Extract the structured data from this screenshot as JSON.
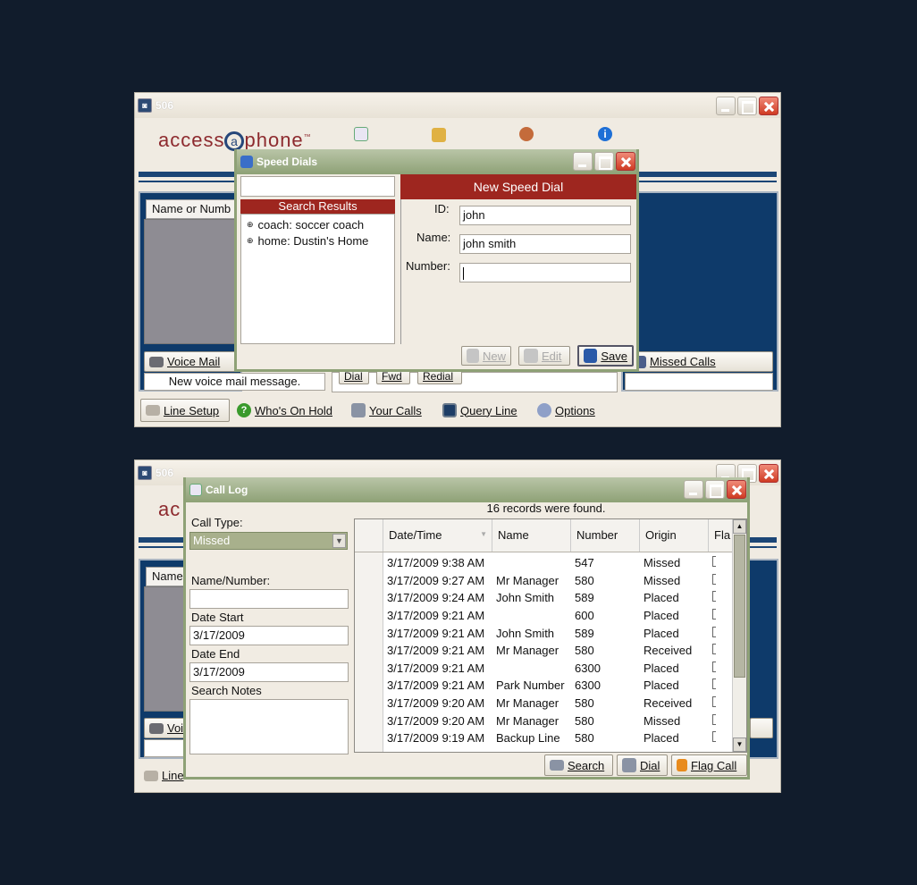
{
  "main_window": {
    "title": "506",
    "logo_text_before": "access",
    "logo_at": "a",
    "logo_text_after": "phone",
    "logo_tm": "™",
    "name_col_header": "Name or Numb",
    "voice_mail_label": "Voice Mail",
    "voice_mail_message": "New voice mail message.",
    "missed_calls_label": "Missed Calls",
    "call_buttons": {
      "dial": "Dial",
      "fwd": "Fwd",
      "redial": "Redial"
    },
    "toolbar": {
      "line_setup": "Line Setup",
      "whos_on_hold": "Who's On Hold",
      "your_calls": "Your Calls",
      "query_line": "Query Line",
      "options": "Options"
    }
  },
  "speed_dials": {
    "title": "Speed Dials",
    "search_value": "",
    "search_results_header": "Search Results",
    "results": [
      {
        "id": "coach",
        "name": "soccer coach",
        "text": "coach: soccer coach"
      },
      {
        "id": "home",
        "name": "Dustin's Home",
        "text": "home: Dustin's Home"
      }
    ],
    "form_header": "New Speed Dial",
    "id_label": "ID:",
    "id_value": "john",
    "name_label": "Name:",
    "name_value": "john smith",
    "number_label": "Number:",
    "number_value": "",
    "buttons": {
      "new": "New",
      "edit": "Edit",
      "save": "Save"
    }
  },
  "second_window": {
    "title": "506",
    "logo_partial": "ac",
    "name_col_partial": "Name",
    "voice_partial": "Voi",
    "line_partial": "Line"
  },
  "call_log": {
    "title": "Call Log",
    "records_found": "16 records were found.",
    "call_type_label": "Call Type:",
    "call_type_value": "Missed",
    "name_number_label": "Name/Number:",
    "name_number_value": "",
    "date_start_label": "Date Start",
    "date_start_value": "3/17/2009",
    "date_end_label": "Date End",
    "date_end_value": "3/17/2009",
    "search_notes_label": "Search Notes",
    "search_notes_value": "",
    "columns": [
      "Date/Time",
      "Name",
      "Number",
      "Origin",
      "Fla"
    ],
    "rows": [
      {
        "datetime": "3/17/2009 9:38 AM",
        "name": "",
        "number": "547",
        "origin": "Missed"
      },
      {
        "datetime": "3/17/2009 9:27 AM",
        "name": "Mr Manager",
        "number": "580",
        "origin": "Missed"
      },
      {
        "datetime": "3/17/2009 9:24 AM",
        "name": "John Smith",
        "number": "589",
        "origin": "Placed"
      },
      {
        "datetime": "3/17/2009 9:21 AM",
        "name": "",
        "number": "600",
        "origin": "Placed"
      },
      {
        "datetime": "3/17/2009 9:21 AM",
        "name": "John Smith",
        "number": "589",
        "origin": "Placed"
      },
      {
        "datetime": "3/17/2009 9:21 AM",
        "name": "Mr Manager",
        "number": "580",
        "origin": "Received"
      },
      {
        "datetime": "3/17/2009 9:21 AM",
        "name": "",
        "number": "6300",
        "origin": "Placed"
      },
      {
        "datetime": "3/17/2009 9:21 AM",
        "name": "Park Number",
        "number": "6300",
        "origin": "Placed"
      },
      {
        "datetime": "3/17/2009 9:20 AM",
        "name": "Mr Manager",
        "number": "580",
        "origin": "Received"
      },
      {
        "datetime": "3/17/2009 9:20 AM",
        "name": "Mr Manager",
        "number": "580",
        "origin": "Missed"
      },
      {
        "datetime": "3/17/2009 9:19 AM",
        "name": "Backup Line",
        "number": "580",
        "origin": "Placed"
      }
    ],
    "buttons": {
      "search": "Search",
      "dial": "Dial",
      "flag_call": "Flag Call"
    }
  }
}
